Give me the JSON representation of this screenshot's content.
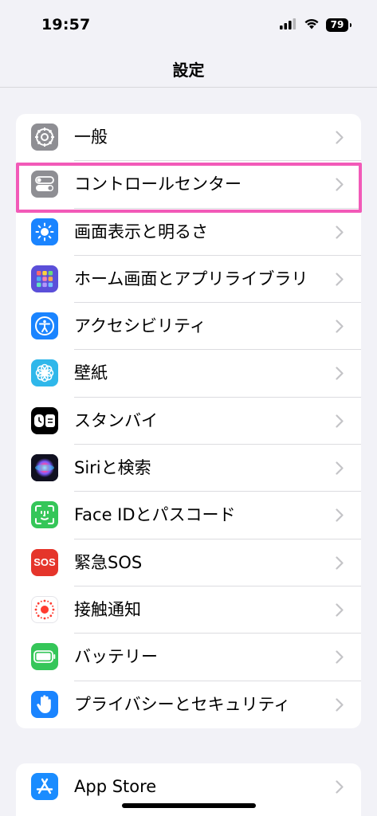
{
  "status": {
    "time": "19:57",
    "battery": "79"
  },
  "nav": {
    "title": "設定"
  },
  "group1": [
    {
      "label": "一般",
      "icon": "gear-icon",
      "color": "#8e8e93"
    },
    {
      "label": "コントロールセンター",
      "icon": "toggles-icon",
      "color": "#8e8e93"
    },
    {
      "label": "画面表示と明るさ",
      "icon": "sun-icon",
      "color": "#1a84ff"
    },
    {
      "label": "ホーム画面とアプリライブラリ",
      "icon": "app-grid-icon",
      "color": "#5b4fd9"
    },
    {
      "label": "アクセシビリティ",
      "icon": "accessibility-icon",
      "color": "#1a84ff"
    },
    {
      "label": "壁紙",
      "icon": "flower-icon",
      "color": "#2fb7ea"
    },
    {
      "label": "スタンバイ",
      "icon": "standby-icon",
      "color": "#000000"
    },
    {
      "label": "Siriと検索",
      "icon": "siri-icon",
      "color": "#1c1c2e"
    },
    {
      "label": "Face IDとパスコード",
      "icon": "face-id-icon",
      "color": "#35c659"
    },
    {
      "label": "緊急SOS",
      "icon": "sos-icon",
      "color": "#e5352b",
      "icon_text": "SOS"
    },
    {
      "label": "接触通知",
      "icon": "exposure-icon",
      "color": "#ffffff"
    },
    {
      "label": "バッテリー",
      "icon": "battery-icon",
      "color": "#35c659"
    },
    {
      "label": "プライバシーとセキュリティ",
      "icon": "hand-icon",
      "color": "#1a84ff"
    }
  ],
  "group2": [
    {
      "label": "App Store",
      "icon": "app-store-icon",
      "color": "#1a8cff"
    }
  ],
  "colors": {
    "highlight": "#f25ab8",
    "background": "#f2f2f7"
  }
}
